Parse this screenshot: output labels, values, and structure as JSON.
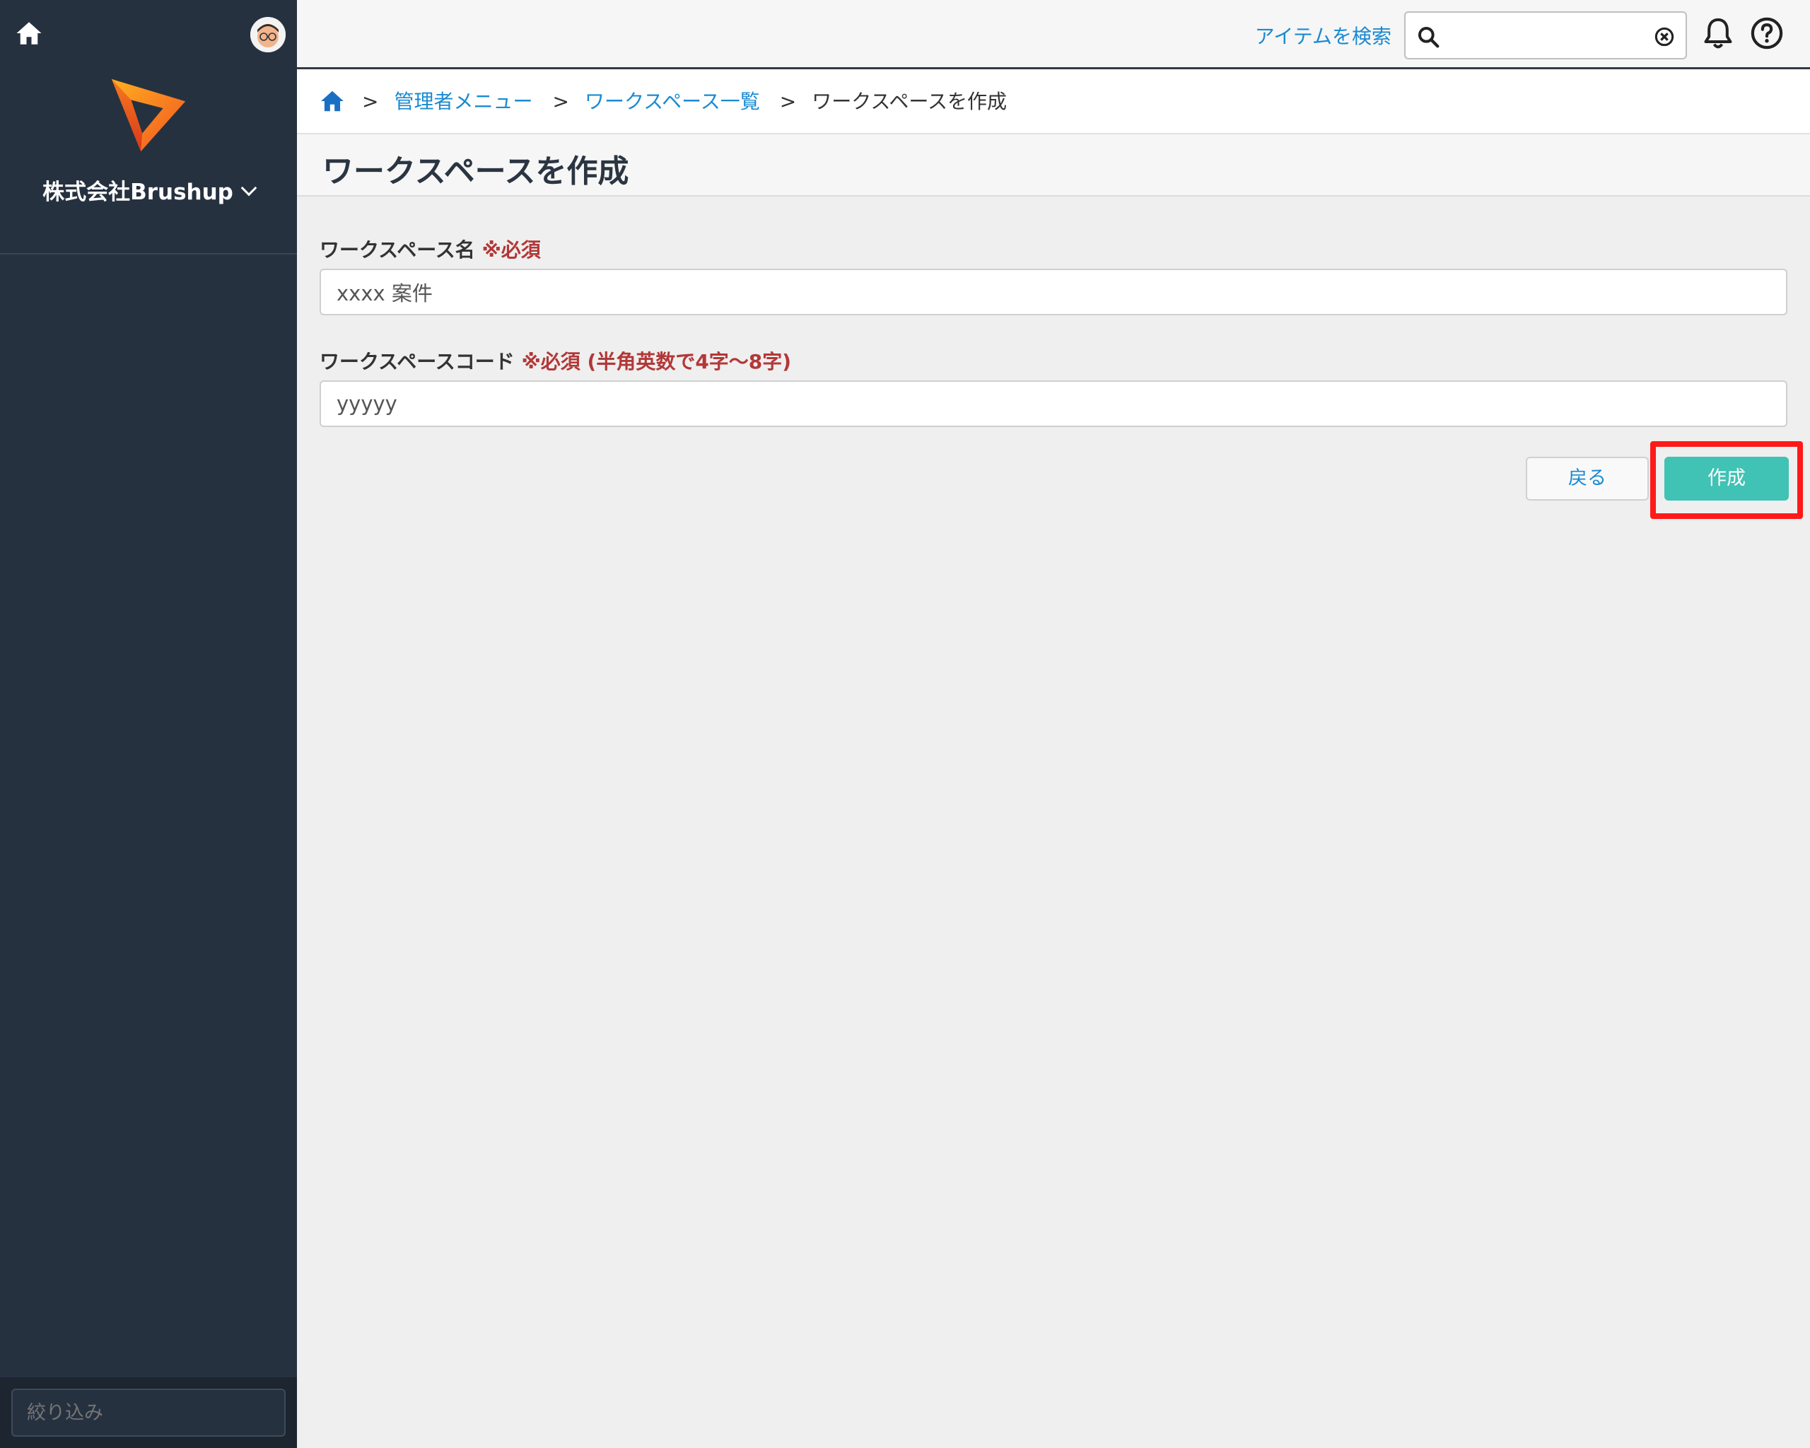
{
  "sidebar": {
    "company_name": "株式会社Brushup",
    "filter_placeholder": "絞り込み"
  },
  "topbar": {
    "search_link": "アイテムを検索",
    "search_value": ""
  },
  "breadcrumb": {
    "sep": ">",
    "items": [
      "管理者メニュー",
      "ワークスペース一覧"
    ],
    "current": "ワークスペースを作成"
  },
  "page": {
    "title": "ワークスペースを作成"
  },
  "form": {
    "name_label": "ワークスペース名",
    "name_required": "※必須",
    "name_value": "xxxx 案件",
    "code_label": "ワークスペースコード",
    "code_required": "※必須 (半角英数で4字〜8字)",
    "code_value": "yyyyy",
    "back_label": "戻る",
    "create_label": "作成"
  },
  "colors": {
    "sidebar_bg": "#263140",
    "accent": "#40c2b4",
    "link": "#1a8ad1",
    "required": "#b23838",
    "highlight": "#ff1a1a"
  }
}
